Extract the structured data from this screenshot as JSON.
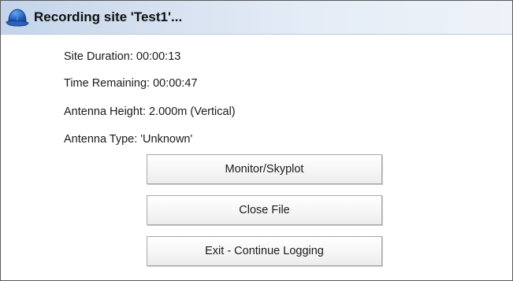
{
  "window": {
    "title": "Recording site 'Test1'...",
    "icon": "hard-hat-icon"
  },
  "info": {
    "site_duration": "Site Duration: 00:00:13",
    "time_remaining": "Time Remaining: 00:00:47",
    "antenna_height": "Antenna Height: 2.000m (Vertical)",
    "antenna_type": "Antenna Type:  'Unknown'"
  },
  "buttons": {
    "monitor_skyplot": "Monitor/Skyplot",
    "close_file": "Close File",
    "exit_continue_logging": "Exit - Continue Logging"
  },
  "colors": {
    "titlebar_start": "#c3d4ea",
    "titlebar_end": "#eef3f9",
    "icon_blue": "#2f6fd0"
  }
}
